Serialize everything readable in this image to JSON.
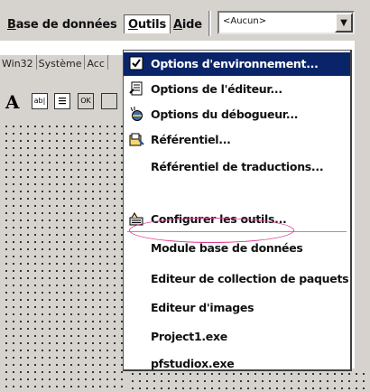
{
  "menubar": {
    "items": [
      {
        "pre": "",
        "u": "B",
        "post": "ase de données"
      },
      {
        "pre": "",
        "u": "O",
        "post": "utils"
      },
      {
        "pre": "",
        "u": "A",
        "post": "ide"
      }
    ],
    "combo_value": "<Aucun>"
  },
  "palette_tabs": [
    "Win32",
    "Système",
    "Acc"
  ],
  "components": {
    "text_a": "A",
    "edit": "ab|",
    "button": "OK"
  },
  "tools_menu": {
    "items": [
      {
        "label": "Options d'environnement...",
        "icon": "env-options-icon",
        "highlighted": true
      },
      {
        "label": "Options de l'éditeur...",
        "icon": "editor-options-icon"
      },
      {
        "label": "Options du débogueur...",
        "icon": "debugger-options-icon"
      },
      {
        "label": "Référentiel...",
        "icon": "repository-icon"
      },
      {
        "label": "Référentiel de traductions...",
        "icon": ""
      },
      {
        "label": "Configurer les outils...",
        "icon": "configure-tools-icon"
      },
      {
        "label": "Module base de données",
        "icon": ""
      },
      {
        "label": "Editeur de collection de paquets",
        "icon": ""
      },
      {
        "label": "Editeur d'images",
        "icon": ""
      },
      {
        "label": "Project1.exe",
        "icon": ""
      },
      {
        "label": "pfstudiox.exe",
        "icon": ""
      }
    ]
  },
  "colors": {
    "highlight": "#0a246a",
    "ellipse": "#e0398f",
    "face": "#d6d3ce"
  }
}
